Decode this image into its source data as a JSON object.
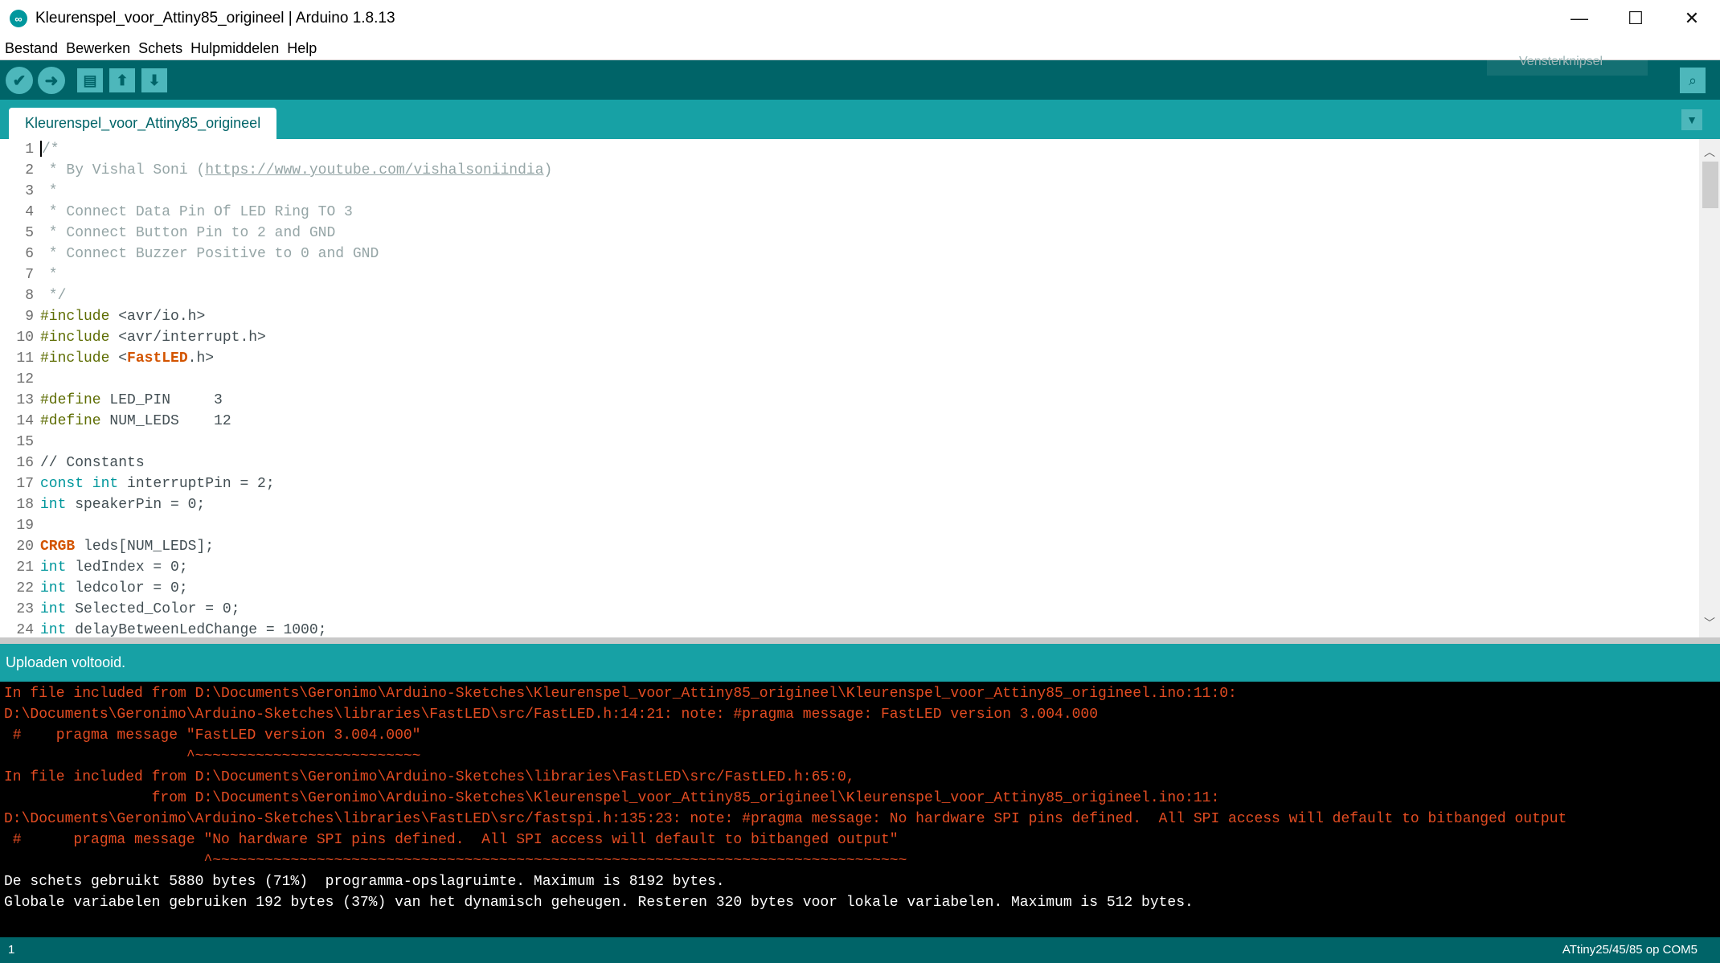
{
  "window": {
    "title": "Kleurenspel_voor_Attiny85_origineel | Arduino 1.8.13",
    "controls": [
      "—",
      "☐",
      "✕"
    ]
  },
  "menu": [
    "Bestand",
    "Bewerken",
    "Schets",
    "Hulpmiddelen",
    "Help"
  ],
  "toolbar": {
    "verify_icon": "checkmark-icon",
    "upload_icon": "arrow-right-icon",
    "new_icon": "new-file-icon",
    "open_icon": "arrow-up-icon",
    "save_icon": "arrow-down-icon",
    "serial_icon": "magnifier-icon",
    "snip_hint": "Vensterknipsel"
  },
  "tab": {
    "label": "Kleurenspel_voor_Attiny85_origineel"
  },
  "code": [
    {
      "n": "1",
      "t": "/*"
    },
    {
      "n": "2",
      "t": " * By Vishal Soni (",
      "link": "https://www.youtube.com/vishalsoniindia",
      "after": ")"
    },
    {
      "n": "3",
      "t": " *"
    },
    {
      "n": "4",
      "t": " * Connect Data Pin Of LED Ring TO 3"
    },
    {
      "n": "5",
      "t": " * Connect Button Pin to 2 and GND"
    },
    {
      "n": "6",
      "t": " * Connect Buzzer Positive to 0 and GND"
    },
    {
      "n": "7",
      "t": " *"
    },
    {
      "n": "8",
      "t": " */"
    },
    {
      "n": "9",
      "pp": "#include",
      "rest": " <avr/io.h>"
    },
    {
      "n": "10",
      "pp": "#include",
      "rest": " <avr/interrupt.h>"
    },
    {
      "n": "11",
      "pp": "#include",
      "rest": " <",
      "ty": "FastLED",
      "rest2": ".h>"
    },
    {
      "n": "12"
    },
    {
      "n": "13",
      "pp": "#define",
      "rest": " LED_PIN     3"
    },
    {
      "n": "14",
      "pp": "#define",
      "rest": " NUM_LEDS    12"
    },
    {
      "n": "15"
    },
    {
      "n": "16",
      "tx": "// Constants"
    },
    {
      "n": "17",
      "kw": "const int",
      "rest": " interruptPin = 2;"
    },
    {
      "n": "18",
      "kw": "int",
      "rest": " speakerPin = 0;"
    },
    {
      "n": "19"
    },
    {
      "n": "20",
      "ty": "CRGB",
      "rest": " leds[NUM_LEDS];"
    },
    {
      "n": "21",
      "kw": "int",
      "rest": " ledIndex = 0;"
    },
    {
      "n": "22",
      "kw": "int",
      "rest": " ledcolor = 0;"
    },
    {
      "n": "23",
      "kw": "int",
      "rest": " Selected_Color = 0;"
    },
    {
      "n": "24",
      "kw": "int",
      "rest": " delayBetweenLedChange = 1000;"
    }
  ],
  "status": {
    "message": "Uploaden voltooid."
  },
  "console": [
    {
      "c": "err",
      "t": "In file included from D:\\Documents\\Geronimo\\Arduino-Sketches\\Kleurenspel_voor_Attiny85_origineel\\Kleurenspel_voor_Attiny85_origineel.ino:11:0:"
    },
    {
      "c": "err",
      "t": "D:\\Documents\\Geronimo\\Arduino-Sketches\\libraries\\FastLED\\src/FastLED.h:14:21: note: #pragma message: FastLED version 3.004.000"
    },
    {
      "c": "err",
      "t": " #    pragma message \"FastLED version 3.004.000\""
    },
    {
      "c": "err",
      "t": "                     ^~~~~~~~~~~~~~~~~~~~~~~~~~~"
    },
    {
      "c": "err",
      "t": "In file included from D:\\Documents\\Geronimo\\Arduino-Sketches\\libraries\\FastLED\\src/FastLED.h:65:0,"
    },
    {
      "c": "err",
      "t": "                 from D:\\Documents\\Geronimo\\Arduino-Sketches\\Kleurenspel_voor_Attiny85_origineel\\Kleurenspel_voor_Attiny85_origineel.ino:11:"
    },
    {
      "c": "err",
      "t": "D:\\Documents\\Geronimo\\Arduino-Sketches\\libraries\\FastLED\\src/fastspi.h:135:23: note: #pragma message: No hardware SPI pins defined.  All SPI access will default to bitbanged output"
    },
    {
      "c": "err",
      "t": " #      pragma message \"No hardware SPI pins defined.  All SPI access will default to bitbanged output\""
    },
    {
      "c": "err",
      "t": "                       ^~~~~~~~~~~~~~~~~~~~~~~~~~~~~~~~~~~~~~~~~~~~~~~~~~~~~~~~~~~~~~~~~~~~~~~~~~~~~~~~~"
    },
    {
      "c": "ok",
      "t": "De schets gebruikt 5880 bytes (71%)  programma-opslagruimte. Maximum is 8192 bytes."
    },
    {
      "c": "ok",
      "t": "Globale variabelen gebruiken 192 bytes (37%) van het dynamisch geheugen. Resteren 320 bytes voor lokale variabelen. Maximum is 512 bytes."
    }
  ],
  "bottombar": {
    "line": "1",
    "board": "ATtiny25/45/85 op COM5"
  }
}
